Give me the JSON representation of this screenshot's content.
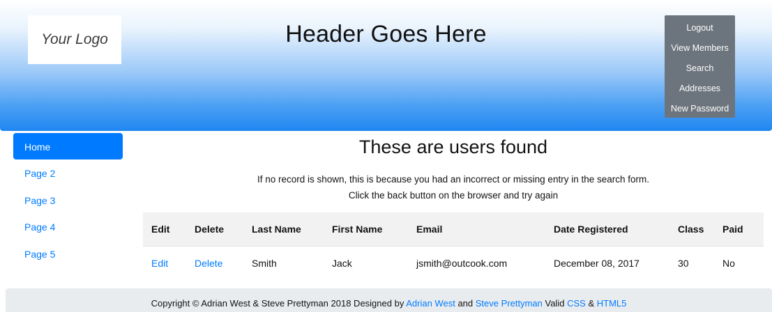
{
  "header": {
    "logo_text": "Your Logo",
    "title": "Header Goes Here",
    "menu": [
      "Logout",
      "View Members",
      "Search",
      "Addresses",
      "New Password"
    ]
  },
  "sidebar": {
    "items": [
      {
        "label": "Home",
        "active": true
      },
      {
        "label": "Page 2",
        "active": false
      },
      {
        "label": "Page 3",
        "active": false
      },
      {
        "label": "Page 4",
        "active": false
      },
      {
        "label": "Page 5",
        "active": false
      }
    ]
  },
  "main": {
    "title": "These are users found",
    "message_line1": "If no record is shown, this is because you had an incorrect or missing entry in the search form.",
    "message_line2": "Click the back button on the browser and try again"
  },
  "table": {
    "columns": [
      "Edit",
      "Delete",
      "Last Name",
      "First Name",
      "Email",
      "Date Registered",
      "Class",
      "Paid"
    ],
    "rows": [
      {
        "edit": "Edit",
        "delete": "Delete",
        "last_name": "Smith",
        "first_name": "Jack",
        "email": "jsmith@outcook.com",
        "date_registered": "December 08, 2017",
        "class": "30",
        "paid": "No"
      }
    ]
  },
  "footer": {
    "prefix": "Copyright © Adrian West & Steve Prettyman 2018 Designed by",
    "link1": "Adrian West",
    "and1": "and",
    "link2": "Steve Prettyman",
    "valid": "Valid",
    "link3": "CSS",
    "amp": "&",
    "link4": "HTML5"
  },
  "colors": {
    "accent": "#007bff",
    "menu_bg": "#6c757d",
    "header_gradient_bottom": "#1f86f1",
    "footer_bg": "#e9ecef"
  }
}
